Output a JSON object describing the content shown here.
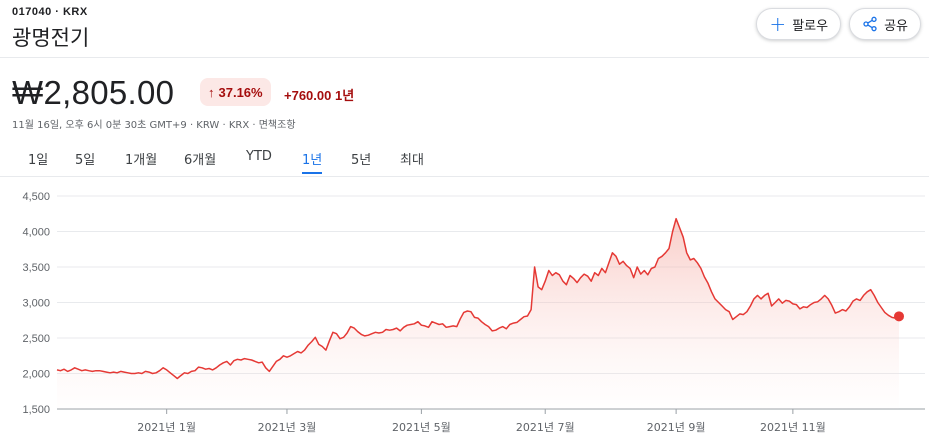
{
  "header": {
    "ticker": "017040 · KRX",
    "company": "광명전기",
    "follow_label": "팔로우",
    "share_label": "공유"
  },
  "quote": {
    "price": "₩2,805.00",
    "percent_change": "37.16%",
    "abs_change": "+760.00 1년",
    "meta": "11월 16일, 오후 6시 0분 30초 GMT+9 · KRW · KRX · 면책조항"
  },
  "tabs": [
    {
      "label": "1일"
    },
    {
      "label": "5일"
    },
    {
      "label": "1개월"
    },
    {
      "label": "6개월"
    },
    {
      "label": "YTD"
    },
    {
      "label": "1년",
      "active": true
    },
    {
      "label": "5년"
    },
    {
      "label": "최대"
    }
  ],
  "colors": {
    "line": "#e53935",
    "fill": "#fcdcd9",
    "accent": "#1a73e8",
    "negative": "#a50e0e"
  },
  "chart_data": {
    "type": "area",
    "y_ticks": [
      "4,500",
      "4,000",
      "3,500",
      "3,000",
      "2,500",
      "2,000",
      "1,500"
    ],
    "ylim": [
      1500,
      4500
    ],
    "x_tick_labels": [
      "2021년 1월",
      "2021년 3월",
      "2021년 5월",
      "2021년 7월",
      "2021년 9월",
      "2021년 11월"
    ],
    "x_tick_index": [
      31,
      65,
      103,
      138,
      175,
      208
    ],
    "values": [
      2050,
      2040,
      2060,
      2030,
      2050,
      2080,
      2060,
      2040,
      2050,
      2040,
      2030,
      2040,
      2040,
      2030,
      2020,
      2010,
      2020,
      2010,
      2030,
      2020,
      2010,
      2000,
      2000,
      2010,
      2000,
      2030,
      2020,
      2000,
      2010,
      2040,
      2080,
      2050,
      2010,
      1970,
      1930,
      1970,
      2010,
      2000,
      2030,
      2040,
      2090,
      2080,
      2060,
      2070,
      2050,
      2080,
      2120,
      2150,
      2170,
      2120,
      2180,
      2200,
      2190,
      2210,
      2200,
      2190,
      2170,
      2150,
      2160,
      2080,
      2030,
      2100,
      2170,
      2200,
      2250,
      2230,
      2250,
      2280,
      2310,
      2290,
      2330,
      2400,
      2450,
      2510,
      2410,
      2380,
      2330,
      2460,
      2580,
      2560,
      2490,
      2510,
      2570,
      2660,
      2640,
      2590,
      2550,
      2530,
      2540,
      2560,
      2580,
      2570,
      2580,
      2620,
      2610,
      2620,
      2640,
      2600,
      2650,
      2680,
      2690,
      2700,
      2730,
      2680,
      2670,
      2650,
      2730,
      2710,
      2690,
      2700,
      2650,
      2660,
      2670,
      2660,
      2770,
      2860,
      2880,
      2870,
      2790,
      2780,
      2730,
      2690,
      2660,
      2600,
      2610,
      2640,
      2660,
      2630,
      2690,
      2710,
      2720,
      2760,
      2800,
      2810,
      2900,
      3500,
      3220,
      3180,
      3300,
      3450,
      3380,
      3420,
      3390,
      3300,
      3250,
      3380,
      3340,
      3280,
      3350,
      3400,
      3370,
      3300,
      3420,
      3380,
      3480,
      3420,
      3560,
      3700,
      3650,
      3540,
      3580,
      3520,
      3480,
      3350,
      3500,
      3400,
      3450,
      3390,
      3480,
      3500,
      3620,
      3650,
      3700,
      3760,
      4000,
      4180,
      4050,
      3920,
      3700,
      3600,
      3620,
      3560,
      3480,
      3360,
      3270,
      3150,
      3050,
      3000,
      2950,
      2900,
      2870,
      2760,
      2800,
      2840,
      2830,
      2870,
      2950,
      3050,
      3100,
      3050,
      3100,
      3130,
      2950,
      3000,
      3050,
      2990,
      3030,
      3020,
      2980,
      2970,
      2910,
      2940,
      2930,
      2970,
      3000,
      3010,
      3050,
      3100,
      3050,
      2960,
      2850,
      2870,
      2900,
      2880,
      2940,
      3020,
      3050,
      3030,
      3100,
      3150,
      3180,
      3100,
      3000,
      2930,
      2860,
      2820,
      2790,
      2780,
      2805
    ]
  }
}
